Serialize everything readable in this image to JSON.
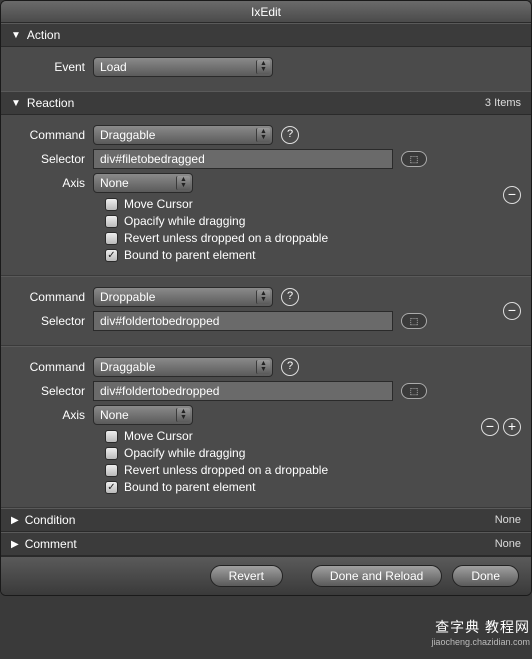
{
  "window": {
    "title": "IxEdit"
  },
  "sections": {
    "action": {
      "label": "Action",
      "expanded": true
    },
    "reaction": {
      "label": "Reaction",
      "expanded": true,
      "count": "3 Items"
    },
    "condition": {
      "label": "Condition",
      "expanded": false,
      "count": "None"
    },
    "comment": {
      "label": "Comment",
      "expanded": false,
      "count": "None"
    }
  },
  "labels": {
    "event": "Event",
    "command": "Command",
    "selector": "Selector",
    "axis": "Axis"
  },
  "action": {
    "event": "Load"
  },
  "checkbox_labels": {
    "move_cursor": "Move Cursor",
    "opacify": "Opacify while dragging",
    "revert": "Revert unless dropped on a droppable",
    "bound": "Bound to parent element"
  },
  "reactions": [
    {
      "command": "Draggable",
      "selector": "div#filetobedragged",
      "axis": "None",
      "checks": {
        "move_cursor": false,
        "opacify": false,
        "revert": false,
        "bound": true
      },
      "buttons": [
        "remove"
      ]
    },
    {
      "command": "Droppable",
      "selector": "div#foldertobedropped",
      "buttons": [
        "remove"
      ]
    },
    {
      "command": "Draggable",
      "selector": "div#foldertobedropped",
      "axis": "None",
      "checks": {
        "move_cursor": false,
        "opacify": false,
        "revert": false,
        "bound": true
      },
      "buttons": [
        "remove",
        "add"
      ]
    }
  ],
  "footer": {
    "revert": "Revert",
    "done_reload": "Done and Reload",
    "done": "Done"
  },
  "glyphs": {
    "help": "?",
    "minus": "−",
    "plus": "+",
    "check": "✓",
    "tri_down": "▼",
    "tri_right": "▶",
    "pick": "⟰"
  },
  "watermark": {
    "line1": "查字典 教程网",
    "line2": "jiaocheng.chazidian.com"
  }
}
